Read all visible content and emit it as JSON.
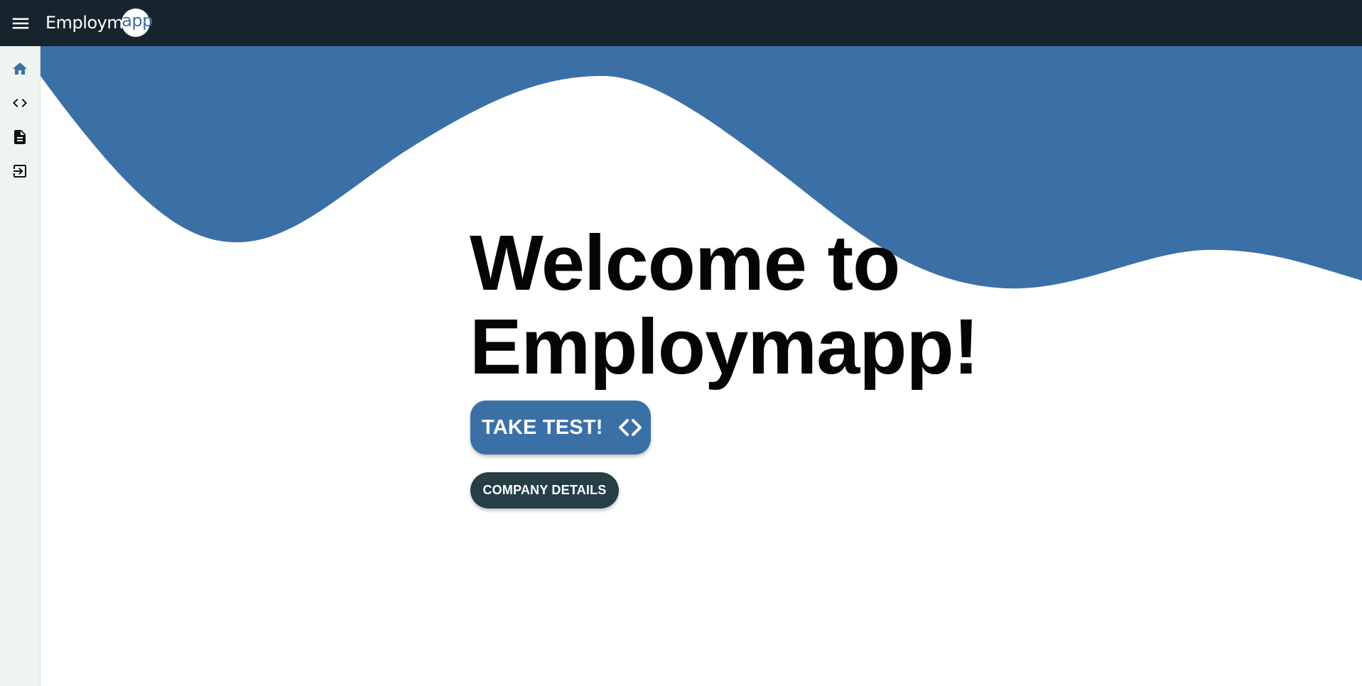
{
  "app": {
    "logo_text_prefix": "Employm",
    "logo_text_suffix": "app"
  },
  "colors": {
    "topbar": "#17242e",
    "sidebar": "#eef4ef",
    "accent": "#3b70a6",
    "secondary_button": "#263f47"
  },
  "sidebar": {
    "items": [
      {
        "icon": "home-icon",
        "active": true
      },
      {
        "icon": "code-icon",
        "active": false
      },
      {
        "icon": "document-icon",
        "active": false
      },
      {
        "icon": "exit-icon",
        "active": false
      }
    ]
  },
  "hero": {
    "title_line1": "Welcome to",
    "title_line2": "Employmapp!"
  },
  "buttons": {
    "take_test_label": "TAKE TEST!",
    "company_details_label": "COMPANY DETAILS"
  }
}
